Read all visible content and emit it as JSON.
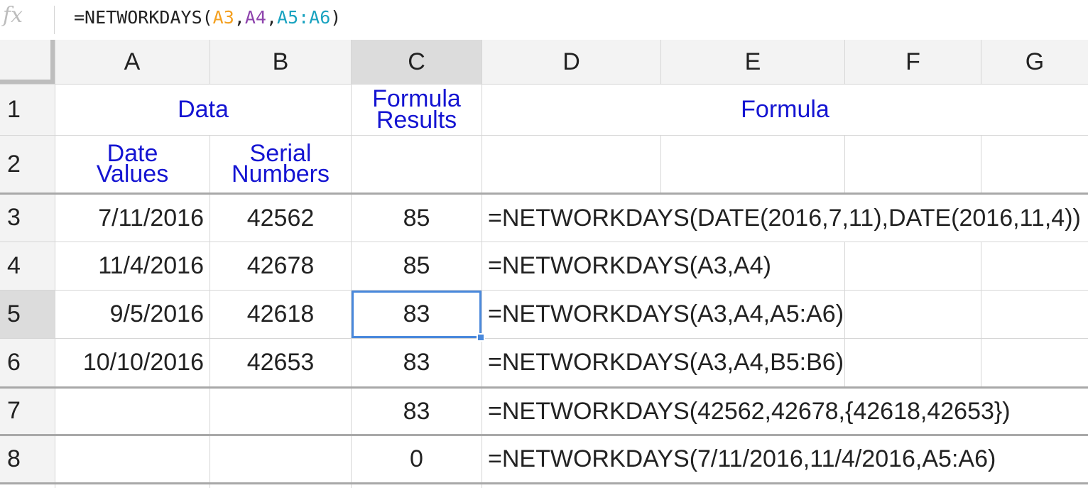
{
  "formula_bar": {
    "icon": "fx-icon",
    "icon_text": "fx",
    "prefix": "=NETWORKDAYS(",
    "arg1": "A3",
    "comma1": ",",
    "arg2": "A4",
    "comma2": ",",
    "arg3": "A5:A6",
    "suffix": ")",
    "arg_colors": [
      "#f4a020",
      "#8e44ad",
      "#1aa3c0"
    ]
  },
  "columns": [
    "A",
    "B",
    "C",
    "D",
    "E",
    "F",
    "G"
  ],
  "rows": [
    "1",
    "2",
    "3",
    "4",
    "5",
    "6",
    "7",
    "8"
  ],
  "selected": {
    "column": "C",
    "row": "5"
  },
  "headers": {
    "data": "Data",
    "formula_results_line1": "Formula",
    "formula_results_line2": "Results",
    "formula": "Formula",
    "date_values_line1": "Date",
    "date_values_line2": "Values",
    "serial_numbers_line1": "Serial",
    "serial_numbers_line2": "Numbers"
  },
  "table": [
    {
      "date": "7/11/2016",
      "serial": "42562",
      "result": "85",
      "formula": "=NETWORKDAYS(DATE(2016,7,11),DATE(2016,11,4))"
    },
    {
      "date": "11/4/2016",
      "serial": "42678",
      "result": "85",
      "formula": "=NETWORKDAYS(A3,A4)"
    },
    {
      "date": "9/5/2016",
      "serial": "42618",
      "result": "83",
      "formula": "=NETWORKDAYS(A3,A4,A5:A6)"
    },
    {
      "date": "10/10/2016",
      "serial": "42653",
      "result": "83",
      "formula": "=NETWORKDAYS(A3,A4,B5:B6)"
    },
    {
      "date": "",
      "serial": "",
      "result": "83",
      "formula": "=NETWORKDAYS(42562,42678,{42618,42653})"
    },
    {
      "date": "",
      "serial": "",
      "result": "0",
      "formula": "=NETWORKDAYS(7/11/2016,11/4/2016,A5:A6)"
    }
  ],
  "colors": {
    "header_text": "#1414d2",
    "selection": "#4a89dc"
  }
}
